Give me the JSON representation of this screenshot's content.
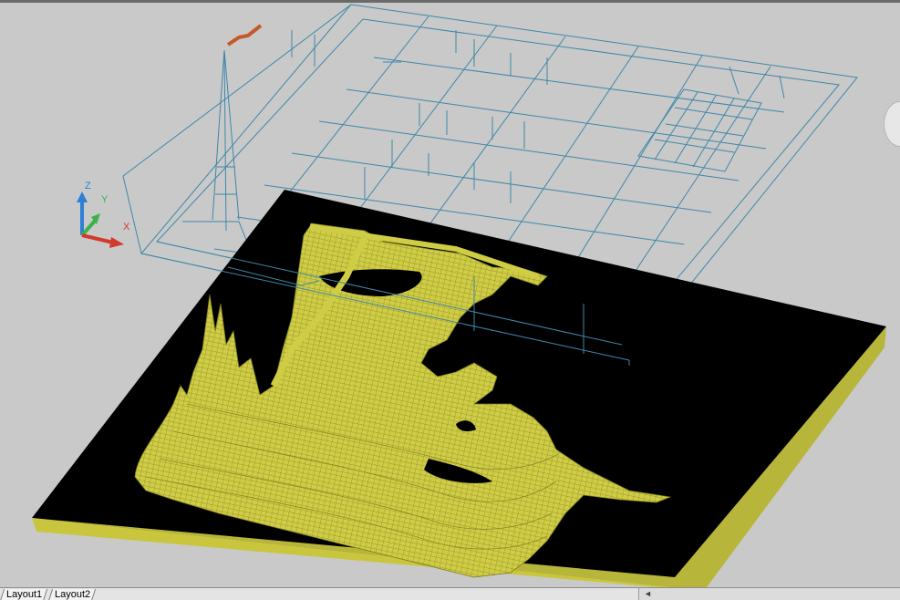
{
  "viewport": {
    "name": "3D model space viewport",
    "background_color": "#c9c9c9",
    "ground_color": "#000000",
    "surface_color": "#c9c63d",
    "wireframe_color": "#3f87a8",
    "antenna_color": "#c45a2a"
  },
  "ucs_icon": {
    "z_label": "Z",
    "y_label": "Y",
    "x_label": "X",
    "z_color": "#2e7fd6",
    "y_color": "#3bb24a",
    "x_color": "#d23a2a"
  },
  "layout_tabs": [
    {
      "label": "Layout1"
    },
    {
      "label": "Layout2"
    }
  ],
  "scrollbar": {
    "left_arrow": "◄"
  }
}
